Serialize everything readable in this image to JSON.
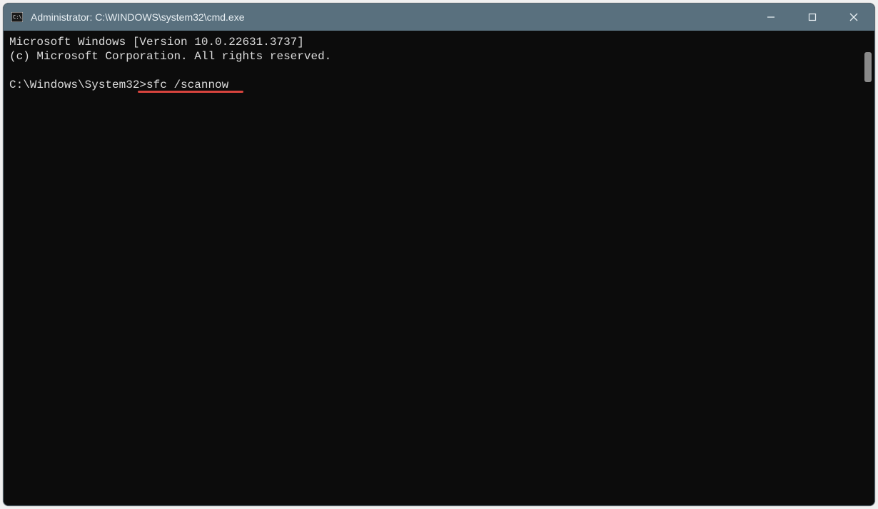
{
  "window": {
    "title": "Administrator: C:\\WINDOWS\\system32\\cmd.exe"
  },
  "terminal": {
    "line1": "Microsoft Windows [Version 10.0.22631.3737]",
    "line2": "(c) Microsoft Corporation. All rights reserved.",
    "blank": "",
    "prompt": "C:\\Windows\\System32>",
    "command": "sfc /scannow"
  },
  "annotation": {
    "underline_color": "#d9443e"
  }
}
